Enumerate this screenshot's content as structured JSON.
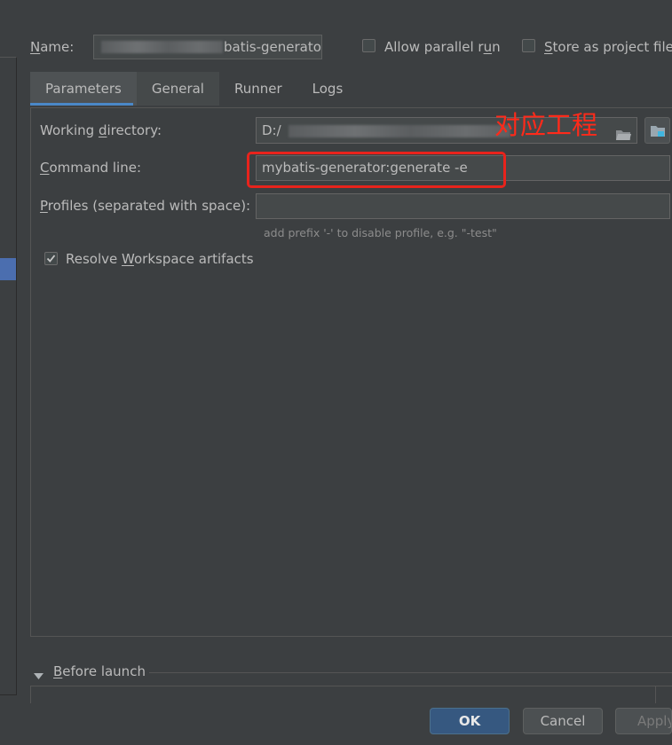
{
  "name_row": {
    "label_prefix": "",
    "label_underlined": "N",
    "label_rest": "ame:",
    "value_visible": "batis-generator",
    "allow_parallel_pre": "Allow parallel r",
    "allow_parallel_u": "u",
    "allow_parallel_post": "n",
    "store_u": "S",
    "store_rest": "tore as project file"
  },
  "tabs": [
    {
      "label": "Parameters"
    },
    {
      "label": "General"
    },
    {
      "label": "Runner"
    },
    {
      "label": "Logs"
    }
  ],
  "working_directory": {
    "label_pre": "Working ",
    "label_u": "d",
    "label_post": "irectory:",
    "value_visible": "D:/"
  },
  "command_line": {
    "label_u": "C",
    "label_rest": "ommand line:",
    "value": "mybatis-generator:generate -e"
  },
  "profiles": {
    "label_u": "P",
    "label_rest": "rofiles (separated with space):",
    "value": "",
    "hint": "add prefix '-' to disable profile, e.g. \"-test\""
  },
  "resolve_workspace": {
    "label_pre": "Resolve ",
    "label_u": "W",
    "label_post": "orkspace artifacts",
    "checked": true
  },
  "annotation": {
    "text": "对应工程",
    "color": "#ff2a1a"
  },
  "before_launch": {
    "label_u": "B",
    "label_rest": "efore launch"
  },
  "buttons": {
    "ok": "OK",
    "cancel": "Cancel",
    "apply": "Apply"
  },
  "colors": {
    "background": "#3c3f41",
    "accent": "#4a88c7",
    "ok_button": "#365880"
  }
}
